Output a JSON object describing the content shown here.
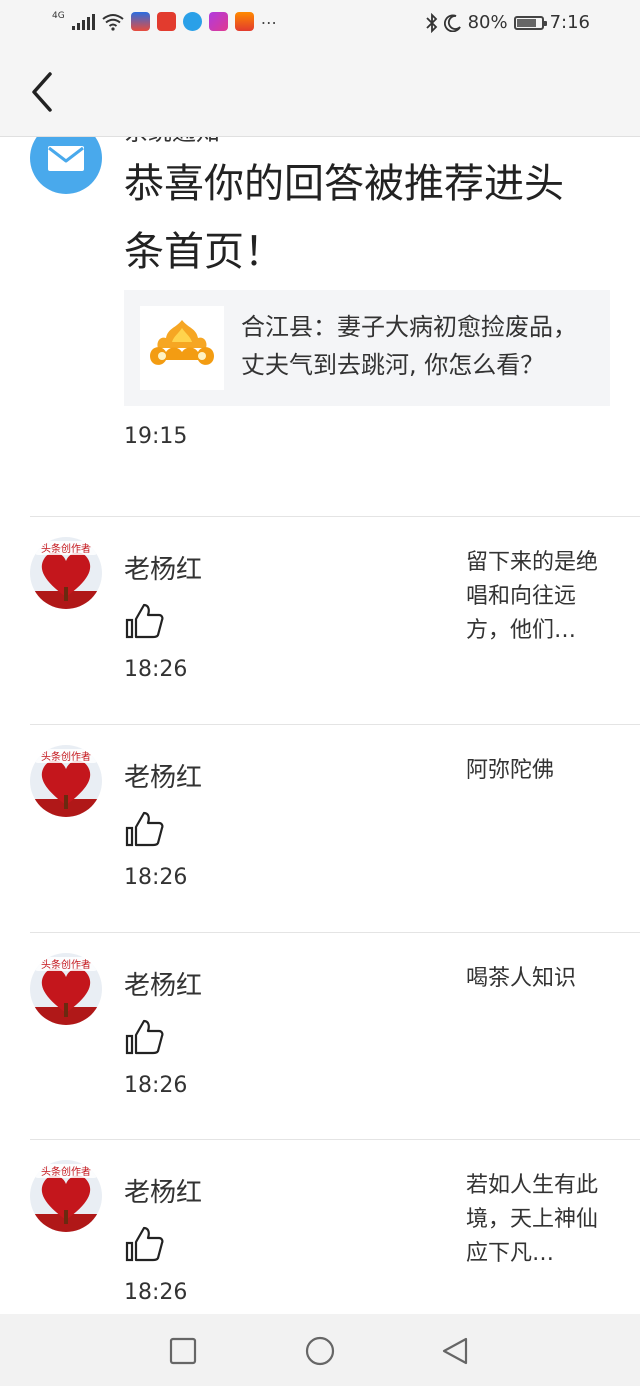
{
  "status_bar": {
    "network": "4G",
    "battery_percent": "80%",
    "battery_level": 0.8,
    "time": "7:16",
    "more": "…",
    "icons": [
      "signal-icon",
      "wifi-icon",
      "app-icon",
      "app-icon",
      "app-icon",
      "app-icon",
      "app-icon",
      "bluetooth-icon",
      "moon-icon",
      "battery-icon"
    ]
  },
  "nav": {
    "back_icon": "chevron-left-icon"
  },
  "system_notice": {
    "sender": "系统通知",
    "title": "恭喜你的回答被推荐进头条首页！",
    "card_text": "合江县：妻子大病初愈捡废品，丈夫气到去跳河, 你怎么看？",
    "time": "19:15",
    "icon": "mail-icon"
  },
  "messages": [
    {
      "name": "老杨红",
      "time": "18:26",
      "quote": "留下来的是绝唱和向往远方，他们…"
    },
    {
      "name": "老杨红",
      "time": "18:26",
      "quote": "阿弥陀佛"
    },
    {
      "name": "老杨红",
      "time": "18:26",
      "quote": "喝茶人知识"
    },
    {
      "name": "老杨红",
      "time": "18:26",
      "quote": "若如人生有此境，天上神仙应下凡…"
    }
  ],
  "avatar_badge_text": "头条创作者",
  "bottom_nav": {
    "recents": "square-icon",
    "home": "circle-icon",
    "back": "triangle-back-icon"
  },
  "colors": {
    "accent_blue": "#49a9ec",
    "heart_red": "#c4161c",
    "divider": "#e4e4e4"
  }
}
